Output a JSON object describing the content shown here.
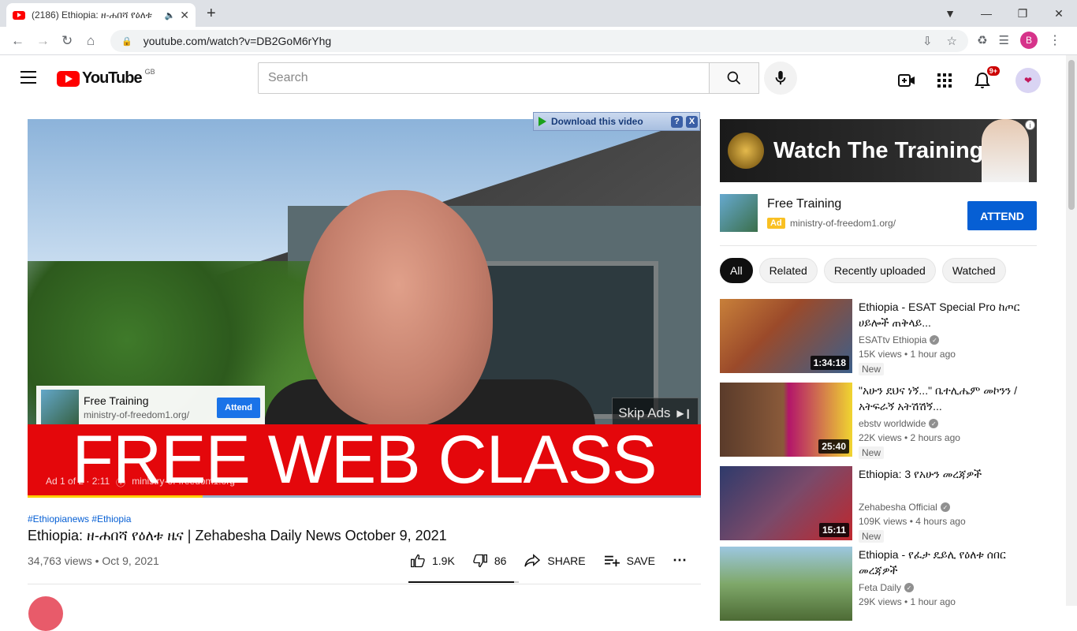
{
  "browser": {
    "tab_title": "(2186) Ethiopia: ዘ-ሐበሻ የዕለቱ",
    "url": "youtube.com/watch?v=DB2GoM6rYhg",
    "profile_letter": "B"
  },
  "header": {
    "logo_text": "YouTube",
    "country_code": "GB",
    "search_placeholder": "Search",
    "notification_count": "9+"
  },
  "player": {
    "download_label": "Download this video",
    "download_help": "?",
    "download_close": "X",
    "overlay_ad": {
      "title": "Free Training",
      "url": "ministry-of-freedom1.org/",
      "button": "Attend"
    },
    "skip_label": "Skip Ads",
    "banner_text": "FREE WEB CLASS",
    "ad_counter": "Ad 1 of 2 · 2:11",
    "ad_domain": "ministry-of-freedom1.org",
    "progress_fraction": 0.26
  },
  "video": {
    "hashtags": "#Ethiopianews #Ethiopia",
    "title": "Ethiopia: ዘ-ሐበሻ የዕለቱ ዜና | Zehabesha Daily News October 9, 2021",
    "views_date": "34,763 views • Oct 9, 2021",
    "likes": "1.9K",
    "dislikes": "86",
    "share": "SHARE",
    "save": "SAVE",
    "like_ratio": 0.96
  },
  "sidebar_ad": {
    "banner_text": "Watch The Training",
    "title": "Free Training",
    "ad_tag": "Ad",
    "url": "ministry-of-freedom1.org/",
    "button": "ATTEND"
  },
  "chips": [
    "All",
    "Related",
    "Recently uploaded",
    "Watched"
  ],
  "recommendations": [
    {
      "title": "Ethiopia - ESAT Special Pro ከጦር ሀይሎች ጠቅላይ...",
      "channel": "ESATtv Ethiopia",
      "meta": "15K views • 1 hour ago",
      "badge": "New",
      "duration": "1:34:18"
    },
    {
      "title": "\"አሁን ደህና ነኝ...\" ቤተሊሔም መኮንን / አትፍራኝ አትሽሽኝ...",
      "channel": "ebstv worldwide",
      "meta": "22K views • 2 hours ago",
      "badge": "New",
      "duration": "25:40"
    },
    {
      "title": "Ethiopia: 3 የአሁን መረጃዎች",
      "channel": "Zehabesha Official",
      "meta": "109K views • 4 hours ago",
      "badge": "New",
      "duration": "15:11"
    },
    {
      "title": "Ethiopia - የፈታ ዴይሊ የዕለቱ ሰበር መረጃዎች",
      "channel": "Feta Daily",
      "meta": "29K views • 1 hour ago",
      "badge": "",
      "duration": ""
    }
  ]
}
